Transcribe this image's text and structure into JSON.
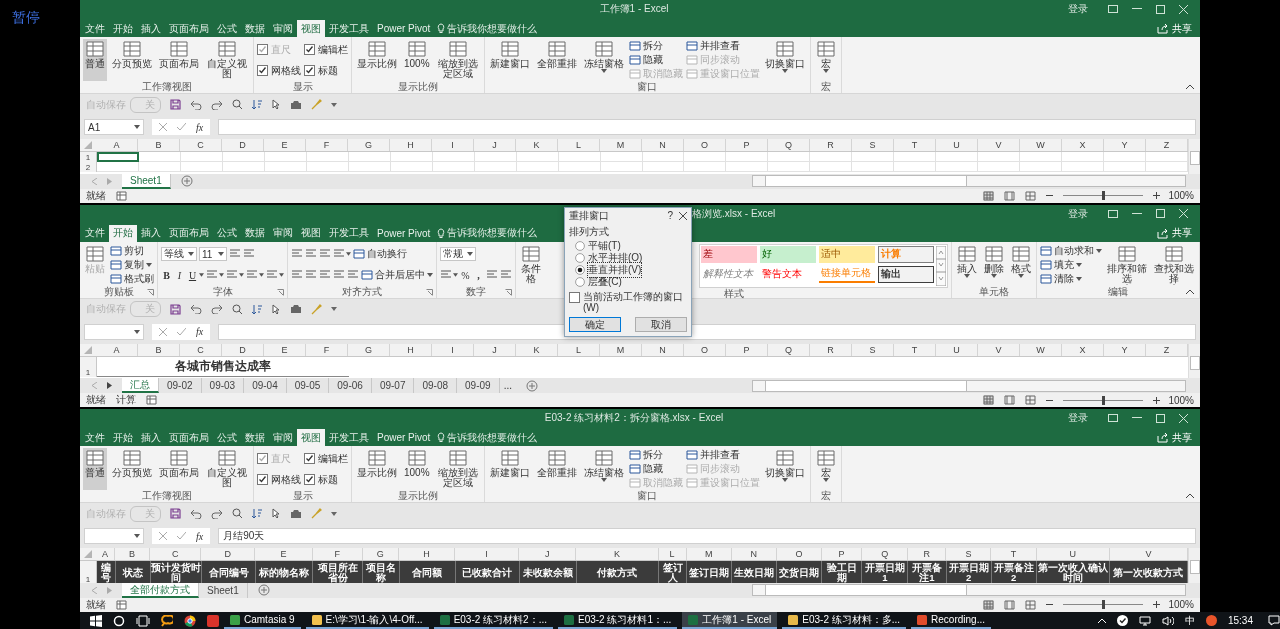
{
  "player": {
    "state_label": "暂停"
  },
  "windows": [
    {
      "title": "工作簿1 - Excel",
      "signin": "登录",
      "share": "共享",
      "tabs": [
        {
          "label": "文件",
          "selected": false
        },
        {
          "label": "开始",
          "selected": false
        },
        {
          "label": "插入",
          "selected": false
        },
        {
          "label": "页面布局",
          "selected": false
        },
        {
          "label": "公式",
          "selected": false
        },
        {
          "label": "数据",
          "selected": false
        },
        {
          "label": "审阅",
          "selected": false
        },
        {
          "label": "视图",
          "selected": true
        },
        {
          "label": "开发工具",
          "selected": false
        },
        {
          "label": "Power Pivot",
          "selected": false
        }
      ],
      "tell_me": "告诉我你想要做什么",
      "ribbon": [
        {
          "label": "工作簿视图",
          "items": [
            {
              "kind": "big",
              "label": "普通",
              "selected": true
            },
            {
              "kind": "big",
              "label": "分页预览",
              "selected": false
            },
            {
              "kind": "big",
              "label": "页面布局",
              "selected": false
            },
            {
              "kind": "big",
              "label": "自定义视图",
              "selected": false
            }
          ]
        },
        {
          "label": "显示",
          "items": [
            {
              "kind": "stack",
              "items": [
                {
                  "kind": "check",
                  "label": "直尺",
                  "checked": true,
                  "disabled": true
                },
                {
                  "kind": "check",
                  "label": "网格线",
                  "checked": true,
                  "disabled": false
                }
              ]
            },
            {
              "kind": "stack",
              "items": [
                {
                  "kind": "check",
                  "label": "编辑栏",
                  "checked": true,
                  "disabled": false
                },
                {
                  "kind": "check",
                  "label": "标题",
                  "checked": true,
                  "disabled": false
                }
              ]
            }
          ]
        },
        {
          "label": "显示比例",
          "items": [
            {
              "kind": "big",
              "label": "显示比例"
            },
            {
              "kind": "big",
              "label": "100%"
            },
            {
              "kind": "big",
              "label": "缩放到选定区域"
            }
          ]
        },
        {
          "label": "窗口",
          "items": [
            {
              "kind": "big",
              "label": "新建窗口"
            },
            {
              "kind": "big",
              "label": "全部重排"
            },
            {
              "kind": "big",
              "label": "冻结窗格",
              "dropdown": true
            },
            {
              "kind": "stack",
              "items": [
                {
                  "kind": "small",
                  "label": "拆分",
                  "disabled": false
                },
                {
                  "kind": "small",
                  "label": "隐藏",
                  "disabled": false
                },
                {
                  "kind": "small",
                  "label": "取消隐藏",
                  "disabled": true
                }
              ]
            },
            {
              "kind": "stack",
              "items": [
                {
                  "kind": "small",
                  "label": "并排查看",
                  "disabled": false
                },
                {
                  "kind": "small",
                  "label": "同步滚动",
                  "disabled": true
                },
                {
                  "kind": "small",
                  "label": "重设窗口位置",
                  "disabled": true
                }
              ]
            },
            {
              "kind": "big",
              "label": "切换窗口",
              "dropdown": true
            }
          ]
        },
        {
          "label": "宏",
          "items": [
            {
              "kind": "big",
              "label": "宏",
              "dropdown": true
            }
          ]
        }
      ],
      "qat": {
        "autosave": "自动保存",
        "toggle": "关"
      },
      "name_box": "A1",
      "insert_function": "fx",
      "columns": [
        "A",
        "B",
        "C",
        "D",
        "E",
        "F",
        "G",
        "H",
        "I",
        "J",
        "K",
        "L",
        "M",
        "N",
        "O",
        "P",
        "Q",
        "R",
        "S",
        "T",
        "U",
        "V",
        "W",
        "X",
        "Y",
        "Z"
      ],
      "rows": [
        {
          "kind": "plain",
          "header": "1",
          "active_cell": true
        },
        {
          "kind": "plain",
          "header": "2",
          "active_cell": false
        }
      ],
      "sheets": [
        {
          "label": "Sheet1",
          "selected": true
        }
      ],
      "status": [
        "就绪"
      ],
      "zoom": {
        "level": 0.5,
        "reading": "100%"
      }
    },
    {
      "title": "格浏览.xlsx - Excel",
      "signin": "登录",
      "share": "共享",
      "tabs": [
        {
          "label": "文件",
          "selected": false
        },
        {
          "label": "开始",
          "selected": true
        },
        {
          "label": "插入",
          "selected": false
        },
        {
          "label": "页面布局",
          "selected": false
        },
        {
          "label": "公式",
          "selected": false
        },
        {
          "label": "数据",
          "selected": false
        },
        {
          "label": "审阅",
          "selected": false
        },
        {
          "label": "视图",
          "selected": false
        },
        {
          "label": "开发工具",
          "selected": false
        },
        {
          "label": "Power Pivot",
          "selected": false
        }
      ],
      "tell_me": "告诉我你想要做什么",
      "ribbon": [
        {
          "label": "剪贴板",
          "launcher": true,
          "items": [
            {
              "kind": "big",
              "label": "粘贴",
              "disabled": true
            },
            {
              "kind": "stack",
              "items": [
                {
                  "kind": "small",
                  "label": "剪切",
                  "disabled": false
                },
                {
                  "kind": "small",
                  "label": "复制",
                  "disabled": false,
                  "dropdown": true
                },
                {
                  "kind": "small",
                  "label": "格式刷",
                  "disabled": false
                }
              ]
            }
          ]
        },
        {
          "label": "字体",
          "launcher": true,
          "items": [
            {
              "kind": "stack",
              "items": [
                {
                  "kind": "row",
                  "items": [
                    {
                      "kind": "combo",
                      "value": "等线"
                    },
                    {
                      "kind": "combo",
                      "value": "11"
                    },
                    {
                      "kind": "icon"
                    },
                    {
                      "kind": "icon"
                    }
                  ]
                },
                {
                  "kind": "row",
                  "items": [
                    {
                      "kind": "bold",
                      "text": "B"
                    },
                    {
                      "kind": "italic",
                      "text": "I"
                    },
                    {
                      "kind": "underline",
                      "text": "U",
                      "dropdown": true
                    },
                    {
                      "kind": "icon",
                      "dropdown": true
                    },
                    {
                      "kind": "icon",
                      "dropdown": true
                    },
                    {
                      "kind": "icon",
                      "dropdown": true
                    },
                    {
                      "kind": "icon",
                      "dropdown": true
                    }
                  ]
                }
              ]
            }
          ]
        },
        {
          "label": "对齐方式",
          "launcher": true,
          "items": [
            {
              "kind": "stack",
              "items": [
                {
                  "kind": "row",
                  "items": [
                    {
                      "kind": "icon"
                    },
                    {
                      "kind": "icon"
                    },
                    {
                      "kind": "icon"
                    },
                    {
                      "kind": "icon",
                      "dropdown": true
                    },
                    {
                      "kind": "small",
                      "label": "自动换行",
                      "disabled": false
                    }
                  ]
                },
                {
                  "kind": "row",
                  "items": [
                    {
                      "kind": "icon"
                    },
                    {
                      "kind": "icon"
                    },
                    {
                      "kind": "icon"
                    },
                    {
                      "kind": "icon"
                    },
                    {
                      "kind": "icon"
                    },
                    {
                      "kind": "small",
                      "label": "合并后居中",
                      "disabled": false,
                      "dropdown": true
                    }
                  ]
                }
              ]
            }
          ]
        },
        {
          "label": "数字",
          "launcher": true,
          "items": [
            {
              "kind": "stack",
              "items": [
                {
                  "kind": "row",
                  "items": [
                    {
                      "kind": "combo",
                      "value": "常规"
                    }
                  ]
                },
                {
                  "kind": "row",
                  "items": [
                    {
                      "kind": "icon",
                      "dropdown": true
                    },
                    {
                      "kind": "glyph",
                      "text": "%"
                    },
                    {
                      "kind": "bold",
                      "text": ","
                    },
                    {
                      "kind": "icon"
                    },
                    {
                      "kind": "icon"
                    }
                  ]
                }
              ]
            }
          ]
        },
        {
          "label": "样式",
          "items": [
            {
              "kind": "big",
              "label": "条件格"
            },
            {
              "kind": "gallery",
              "items": [
                {
                  "kind": "bad",
                  "label": "差"
                },
                {
                  "kind": "good",
                  "label": "好"
                },
                {
                  "kind": "neutral",
                  "label": "适中"
                },
                {
                  "kind": "calculation",
                  "label": "计算"
                },
                {
                  "kind": "explanatory",
                  "label": "解释性文本"
                },
                {
                  "kind": "warning",
                  "label": "警告文本"
                },
                {
                  "kind": "linked",
                  "label": "链接单元格"
                },
                {
                  "kind": "output",
                  "label": "输出"
                }
              ]
            }
          ]
        },
        {
          "label": "单元格",
          "items": [
            {
              "kind": "big",
              "label": "插入",
              "dropdown": true
            },
            {
              "kind": "big",
              "label": "删除",
              "dropdown": true
            },
            {
              "kind": "big",
              "label": "格式",
              "dropdown": true
            }
          ]
        },
        {
          "label": "编辑",
          "items": [
            {
              "kind": "stack",
              "items": [
                {
                  "kind": "small",
                  "label": "自动求和",
                  "disabled": false,
                  "dropdown": true
                },
                {
                  "kind": "small",
                  "label": "填充",
                  "disabled": false,
                  "dropdown": true
                },
                {
                  "kind": "small",
                  "label": "清除",
                  "disabled": false,
                  "dropdown": true
                }
              ]
            },
            {
              "kind": "big",
              "label": "排序和筛选",
              "dropdown": true
            },
            {
              "kind": "big",
              "label": "查找和选择",
              "dropdown": true
            }
          ]
        }
      ],
      "qat": {
        "autosave": "自动保存",
        "toggle": "关"
      },
      "insert_function": "fx",
      "columns": [
        "A",
        "B",
        "C",
        "D",
        "E",
        "F",
        "G",
        "H",
        "I",
        "J",
        "K",
        "L",
        "M",
        "N",
        "O",
        "P",
        "Q",
        "R",
        "S",
        "T",
        "U",
        "V",
        "W",
        "X",
        "Y",
        "Z"
      ],
      "rows": [
        {
          "kind": "title",
          "header": "1",
          "text": "各城市销售达成率"
        }
      ],
      "sheets": [
        {
          "label": "汇总",
          "selected": true
        },
        {
          "label": "09-02",
          "selected": false
        },
        {
          "label": "09-03",
          "selected": false
        },
        {
          "label": "09-04",
          "selected": false
        },
        {
          "label": "09-05",
          "selected": false
        },
        {
          "label": "09-06",
          "selected": false
        },
        {
          "label": "09-07",
          "selected": false
        },
        {
          "label": "09-08",
          "selected": false
        },
        {
          "label": "09-09",
          "selected": false
        }
      ],
      "more_sheets": "...",
      "status": [
        "就绪",
        "计算"
      ],
      "zoom": {
        "level": 0.5,
        "reading": "100%"
      },
      "dialog": {
        "title": "重排窗口",
        "help": "?",
        "section": "排列方式",
        "options": [
          {
            "label": "平铺(T)",
            "selected": false
          },
          {
            "label": "水平并排(O)",
            "selected": false
          },
          {
            "label": "垂直并排(V)",
            "selected": true
          },
          {
            "label": "层叠(C)",
            "selected": false
          }
        ],
        "checkbox": {
          "label": "当前活动工作簿的窗口(W)",
          "checked": false
        },
        "buttons": [
          "确定",
          "取消"
        ]
      }
    },
    {
      "title": "E03-2 练习材料2：拆分窗格.xlsx - Excel",
      "signin": "登录",
      "share": "共享",
      "tabs": [
        {
          "label": "文件",
          "selected": false
        },
        {
          "label": "开始",
          "selected": false
        },
        {
          "label": "插入",
          "selected": false
        },
        {
          "label": "页面布局",
          "selected": false
        },
        {
          "label": "公式",
          "selected": false
        },
        {
          "label": "数据",
          "selected": false
        },
        {
          "label": "审阅",
          "selected": false
        },
        {
          "label": "视图",
          "selected": true
        },
        {
          "label": "开发工具",
          "selected": false
        },
        {
          "label": "Power Pivot",
          "selected": false
        }
      ],
      "tell_me": "告诉我你想要做什么",
      "ribbon": [
        {
          "label": "工作簿视图",
          "items": [
            {
              "kind": "big",
              "label": "普通",
              "selected": true
            },
            {
              "kind": "big",
              "label": "分页预览",
              "selected": false
            },
            {
              "kind": "big",
              "label": "页面布局",
              "selected": false
            },
            {
              "kind": "big",
              "label": "自定义视图",
              "selected": false
            }
          ]
        },
        {
          "label": "显示",
          "items": [
            {
              "kind": "stack",
              "items": [
                {
                  "kind": "check",
                  "label": "直尺",
                  "checked": true,
                  "disabled": true
                },
                {
                  "kind": "check",
                  "label": "网格线",
                  "checked": true,
                  "disabled": false
                }
              ]
            },
            {
              "kind": "stack",
              "items": [
                {
                  "kind": "check",
                  "label": "编辑栏",
                  "checked": true,
                  "disabled": false
                },
                {
                  "kind": "check",
                  "label": "标题",
                  "checked": true,
                  "disabled": false
                }
              ]
            }
          ]
        },
        {
          "label": "显示比例",
          "items": [
            {
              "kind": "big",
              "label": "显示比例"
            },
            {
              "kind": "big",
              "label": "100%"
            },
            {
              "kind": "big",
              "label": "缩放到选定区域"
            }
          ]
        },
        {
          "label": "窗口",
          "items": [
            {
              "kind": "big",
              "label": "新建窗口"
            },
            {
              "kind": "big",
              "label": "全部重排"
            },
            {
              "kind": "big",
              "label": "冻结窗格",
              "dropdown": true
            },
            {
              "kind": "stack",
              "items": [
                {
                  "kind": "small",
                  "label": "拆分",
                  "disabled": false
                },
                {
                  "kind": "small",
                  "label": "隐藏",
                  "disabled": false
                },
                {
                  "kind": "small",
                  "label": "取消隐藏",
                  "disabled": true
                }
              ]
            },
            {
              "kind": "stack",
              "items": [
                {
                  "kind": "small",
                  "label": "并排查看",
                  "disabled": false
                },
                {
                  "kind": "small",
                  "label": "同步滚动",
                  "disabled": true
                },
                {
                  "kind": "small",
                  "label": "重设窗口位置",
                  "disabled": true
                }
              ]
            },
            {
              "kind": "big",
              "label": "切换窗口",
              "dropdown": true
            }
          ]
        },
        {
          "label": "宏",
          "items": [
            {
              "kind": "big",
              "label": "宏",
              "dropdown": true
            }
          ]
        }
      ],
      "qat": {
        "autosave": "自动保存",
        "toggle": "关"
      },
      "insert_function": "fx",
      "formula": "月结90天",
      "columns": [
        "A",
        "B",
        "C",
        "D",
        "E",
        "F",
        "G",
        "H",
        "I",
        "J",
        "K",
        "L",
        "M",
        "N",
        "O",
        "P",
        "Q",
        "R",
        "S",
        "T",
        "U",
        "V"
      ],
      "rows": [
        {
          "kind": "header",
          "header": "1",
          "cells": [
            "编号",
            "状态",
            "预计发货时间",
            "合同编号",
            "标的物名称",
            "项目所在省份",
            "项目名称",
            "合同额",
            "已收款合计",
            "未收款余额",
            "付款方式",
            "签订人",
            "签订日期",
            "生效日期",
            "交货日期",
            "验工日期",
            "开票日期1",
            "开票备注1",
            "开票日期2",
            "开票备注2",
            "第一次收入确认时间",
            "第一次收款方式"
          ]
        }
      ],
      "sheets": [
        {
          "label": "全部付款方式",
          "selected": true
        },
        {
          "label": "Sheet1",
          "selected": false
        }
      ],
      "status": [
        "就绪"
      ],
      "zoom": {
        "level": 0.5,
        "reading": "100%"
      }
    }
  ],
  "taskbar": {
    "apps": [
      {
        "kind": "camtasia",
        "label": "Camtasia 9",
        "selected": false
      },
      {
        "kind": "explorer",
        "label": "E:\\学习\\1-输入\\4-Off...",
        "selected": false
      },
      {
        "kind": "excel",
        "label": "E03-2 练习材料2：...",
        "selected": false
      },
      {
        "kind": "excel",
        "label": "E03-2 练习材料1：...",
        "selected": false
      },
      {
        "kind": "excel",
        "label": "工作簿1 - Excel",
        "selected": true
      },
      {
        "kind": "folder",
        "label": "E03-2 练习材料：多...",
        "selected": false
      },
      {
        "kind": "recording",
        "label": "Recording...",
        "selected": false
      }
    ],
    "ime": "中",
    "time": "15:34"
  }
}
